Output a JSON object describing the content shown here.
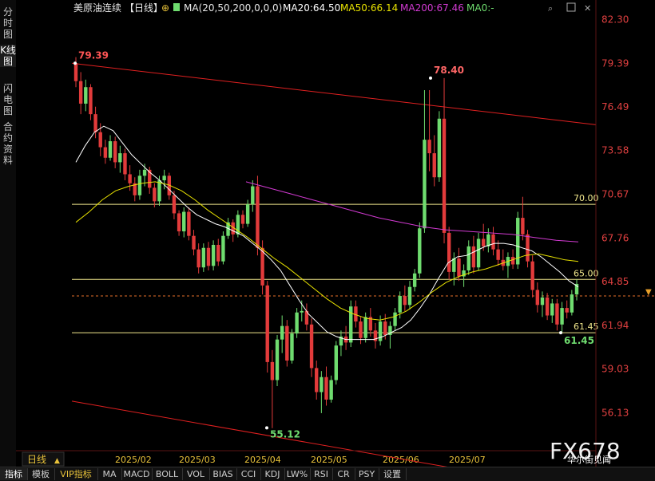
{
  "sidebar": {
    "tabs": [
      {
        "label": "分时图"
      },
      {
        "label": "K线图"
      },
      {
        "label": "闪电图"
      },
      {
        "label": "合约资料"
      }
    ]
  },
  "header": {
    "title": "美原油连续",
    "period": "【日线】",
    "ma_params": "MA(20,50,200,0,0,0)",
    "ma20": "MA20:64.50",
    "ma50": "MA50:66.14",
    "ma200": "MA200:67.46",
    "ma0": "MA0:-"
  },
  "period_button": "日线",
  "watermark": "FX678",
  "watermark_sub": "华尔街见闻",
  "bottom_tabs": [
    "指标",
    "模板",
    "VIP指标",
    "MA",
    "MACD",
    "BOLL",
    "VOL",
    "BIAS",
    "CCI",
    "KDJ",
    "LW%",
    "RSI",
    "CR",
    "PSY",
    "设置"
  ],
  "colors": {
    "background": "#000000",
    "up": "#6fdc6f",
    "down": "#e23b3b",
    "ma20": "#ffffff",
    "ma50": "#e8e200",
    "ma200": "#d23ad2",
    "channel": "#e02020",
    "horizontal": "#f0e68c",
    "axis_text": "#e04040"
  },
  "chart_data": {
    "type": "candlestick",
    "y_ticks": [
      "82.30",
      "79.39",
      "76.49",
      "73.58",
      "70.67",
      "67.76",
      "64.85",
      "61.94",
      "59.03",
      "56.13"
    ],
    "ylim": [
      53.6,
      83.6
    ],
    "x_ticks": [
      "2025/02",
      "2025/03",
      "2025/04",
      "2025/05",
      "2025/06",
      "2025/07"
    ],
    "annotations": [
      {
        "label": "79.39",
        "value": 79.39
      },
      {
        "label": "78.40",
        "value": 78.4
      },
      {
        "label": "55.12",
        "value": 55.12
      },
      {
        "label": "61.45",
        "value": 61.45
      }
    ],
    "horizontal_lines": [
      {
        "label": "70.00",
        "value": 70.0
      },
      {
        "label": "65.00",
        "value": 65.0
      },
      {
        "label": "61.45",
        "value": 61.45
      }
    ],
    "current_price": 63.9,
    "channel_lines": [
      {
        "from": 79.39,
        "to": 75.3
      },
      {
        "from": 56.9,
        "to": 52.4
      }
    ],
    "candles": [
      [
        79.4,
        79.8,
        77.8,
        78.2
      ],
      [
        78.2,
        78.8,
        76.0,
        76.7
      ],
      [
        76.7,
        78.3,
        76.2,
        77.8
      ],
      [
        77.8,
        78.0,
        75.6,
        76.0
      ],
      [
        76.0,
        76.5,
        74.4,
        74.8
      ],
      [
        74.8,
        75.4,
        73.2,
        73.8
      ],
      [
        73.8,
        74.3,
        72.7,
        73.1
      ],
      [
        73.1,
        74.6,
        72.9,
        74.2
      ],
      [
        74.2,
        74.5,
        72.4,
        72.8
      ],
      [
        72.8,
        73.9,
        72.1,
        73.4
      ],
      [
        73.4,
        73.7,
        71.6,
        72.0
      ],
      [
        72.0,
        72.6,
        70.9,
        71.4
      ],
      [
        71.4,
        71.8,
        70.2,
        70.6
      ],
      [
        70.6,
        72.3,
        70.3,
        71.9
      ],
      [
        71.9,
        72.7,
        71.2,
        72.3
      ],
      [
        72.3,
        72.5,
        70.7,
        71.1
      ],
      [
        71.1,
        71.4,
        69.8,
        70.2
      ],
      [
        70.2,
        71.9,
        69.9,
        71.6
      ],
      [
        71.6,
        72.3,
        71.0,
        71.9
      ],
      [
        71.9,
        72.1,
        70.3,
        70.6
      ],
      [
        70.6,
        70.9,
        69.0,
        69.4
      ],
      [
        69.4,
        69.6,
        67.9,
        68.2
      ],
      [
        68.2,
        69.8,
        67.8,
        69.5
      ],
      [
        69.5,
        69.8,
        67.6,
        67.9
      ],
      [
        67.9,
        68.3,
        66.6,
        67.0
      ],
      [
        67.0,
        67.4,
        65.4,
        65.8
      ],
      [
        65.8,
        67.4,
        65.5,
        67.1
      ],
      [
        67.1,
        67.5,
        65.6,
        65.9
      ],
      [
        65.9,
        67.6,
        65.6,
        67.3
      ],
      [
        67.3,
        67.7,
        65.9,
        66.2
      ],
      [
        66.2,
        68.2,
        66.0,
        67.9
      ],
      [
        67.9,
        69.1,
        67.7,
        68.8
      ],
      [
        68.8,
        69.0,
        67.5,
        68.0
      ],
      [
        68.0,
        69.6,
        67.8,
        69.3
      ],
      [
        69.3,
        69.6,
        68.4,
        68.7
      ],
      [
        68.7,
        70.3,
        68.5,
        70.0
      ],
      [
        70.0,
        71.6,
        69.5,
        71.2
      ],
      [
        71.2,
        71.9,
        66.6,
        67.1
      ],
      [
        67.1,
        67.6,
        64.0,
        64.6
      ],
      [
        64.6,
        64.9,
        58.8,
        59.5
      ],
      [
        59.5,
        60.3,
        55.1,
        58.3
      ],
      [
        58.3,
        61.3,
        57.9,
        61.0
      ],
      [
        61.0,
        62.6,
        60.1,
        61.9
      ],
      [
        61.9,
        62.3,
        59.2,
        59.6
      ],
      [
        59.6,
        61.7,
        59.4,
        61.4
      ],
      [
        61.4,
        63.1,
        61.1,
        62.8
      ],
      [
        62.8,
        63.6,
        62.2,
        62.9
      ],
      [
        62.9,
        63.4,
        61.6,
        62.0
      ],
      [
        62.0,
        62.4,
        58.5,
        59.1
      ],
      [
        59.1,
        59.6,
        57.0,
        57.5
      ],
      [
        57.5,
        58.9,
        56.1,
        58.5
      ],
      [
        58.5,
        59.2,
        56.6,
        57.0
      ],
      [
        57.0,
        58.6,
        56.8,
        58.3
      ],
      [
        58.3,
        60.9,
        58.0,
        60.6
      ],
      [
        60.6,
        61.6,
        59.9,
        61.2
      ],
      [
        61.2,
        61.9,
        60.3,
        60.8
      ],
      [
        60.8,
        63.6,
        60.5,
        63.2
      ],
      [
        63.2,
        63.6,
        61.8,
        62.2
      ],
      [
        62.2,
        62.5,
        60.7,
        61.1
      ],
      [
        61.1,
        62.8,
        60.8,
        62.5
      ],
      [
        62.5,
        63.1,
        61.2,
        61.6
      ],
      [
        61.6,
        62.1,
        60.4,
        60.9
      ],
      [
        60.9,
        62.6,
        60.6,
        62.2
      ],
      [
        62.2,
        62.7,
        61.0,
        61.3
      ],
      [
        61.3,
        62.2,
        60.4,
        61.9
      ],
      [
        61.9,
        63.1,
        61.6,
        62.8
      ],
      [
        62.8,
        64.2,
        62.4,
        63.9
      ],
      [
        63.9,
        64.6,
        62.9,
        63.3
      ],
      [
        63.3,
        64.9,
        63.0,
        64.5
      ],
      [
        64.5,
        65.7,
        64.2,
        65.4
      ],
      [
        65.4,
        68.8,
        65.1,
        68.4
      ],
      [
        68.4,
        77.6,
        68.1,
        74.3
      ],
      [
        74.3,
        77.6,
        72.2,
        73.4
      ],
      [
        73.4,
        74.6,
        71.2,
        71.8
      ],
      [
        71.8,
        76.2,
        71.5,
        75.7
      ],
      [
        75.7,
        78.4,
        67.4,
        68.1
      ],
      [
        68.1,
        68.5,
        65.0,
        65.5
      ],
      [
        65.5,
        66.8,
        64.6,
        66.4
      ],
      [
        66.4,
        67.1,
        64.9,
        65.2
      ],
      [
        65.2,
        66.0,
        64.5,
        65.6
      ],
      [
        65.6,
        67.6,
        65.3,
        67.2
      ],
      [
        67.2,
        67.9,
        65.4,
        65.8
      ],
      [
        65.8,
        68.1,
        65.6,
        67.7
      ],
      [
        67.7,
        68.7,
        66.9,
        67.2
      ],
      [
        67.2,
        68.4,
        66.8,
        68.0
      ],
      [
        68.0,
        68.5,
        66.6,
        67.0
      ],
      [
        67.0,
        67.6,
        65.9,
        66.3
      ],
      [
        66.3,
        67.0,
        65.6,
        65.9
      ],
      [
        65.9,
        66.8,
        65.1,
        66.5
      ],
      [
        66.5,
        67.0,
        65.7,
        66.0
      ],
      [
        66.0,
        69.5,
        65.7,
        69.1
      ],
      [
        69.1,
        70.5,
        67.6,
        68.0
      ],
      [
        68.0,
        68.3,
        65.8,
        66.2
      ],
      [
        66.2,
        66.6,
        63.8,
        64.3
      ],
      [
        64.3,
        64.8,
        62.8,
        63.3
      ],
      [
        63.3,
        64.2,
        62.5,
        63.8
      ],
      [
        63.8,
        64.1,
        62.3,
        62.6
      ],
      [
        62.6,
        63.7,
        62.1,
        63.4
      ],
      [
        63.4,
        63.7,
        61.6,
        62.0
      ],
      [
        62.0,
        63.5,
        61.4,
        63.1
      ],
      [
        63.1,
        63.6,
        62.4,
        62.8
      ],
      [
        62.8,
        64.3,
        62.6,
        64.0
      ],
      [
        64.0,
        65.0,
        63.6,
        64.7
      ]
    ],
    "ma20": [
      72.8,
      73.9,
      74.8,
      75.2,
      74.9,
      74.1,
      73.3,
      72.7,
      72.1,
      71.6,
      71.0,
      70.4,
      69.8,
      69.3,
      69.0,
      68.7,
      68.5,
      68.2,
      67.9,
      67.4,
      66.9,
      66.3,
      65.6,
      64.6,
      63.6,
      62.7,
      62.1,
      61.5,
      61.2,
      61.0,
      61.0,
      61.0,
      61.0,
      61.2,
      61.5,
      61.8,
      62.3,
      63.1,
      64.0,
      65.1,
      66.1,
      66.5,
      66.6,
      66.9,
      67.2,
      67.4,
      67.4,
      67.3,
      67.1,
      66.9,
      66.5,
      66.0,
      65.5,
      64.9,
      64.5
    ],
    "ma50": [
      68.8,
      69.5,
      70.3,
      70.9,
      71.2,
      71.4,
      71.5,
      71.3,
      70.9,
      70.3,
      69.6,
      69.0,
      68.4,
      67.8,
      67.1,
      66.4,
      65.8,
      65.1,
      64.4,
      63.7,
      63.1,
      62.7,
      62.4,
      62.3,
      62.5,
      62.9,
      63.5,
      64.2,
      64.8,
      65.2,
      65.5,
      65.7,
      66.0,
      66.3,
      66.6,
      66.7,
      66.5,
      66.3,
      66.2
    ],
    "ma200": [
      71.5,
      71.1,
      70.7,
      70.3,
      69.9,
      69.5,
      69.1,
      68.8,
      68.5,
      68.3,
      68.2,
      68.1,
      68.0,
      67.8,
      67.6,
      67.5
    ]
  }
}
